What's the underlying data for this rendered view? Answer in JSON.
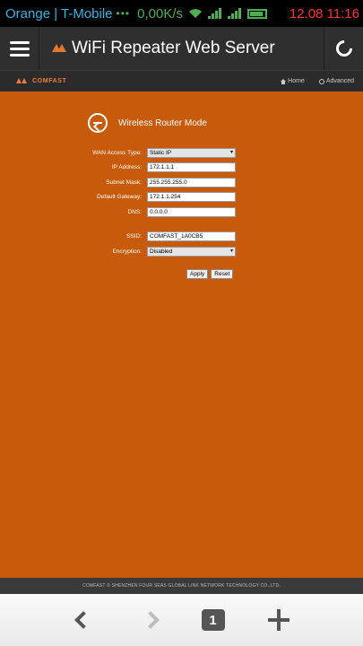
{
  "status_bar": {
    "carrier": "Orange | T-Mobile",
    "dots": "•••",
    "speed": "0,00K/s",
    "datetime": "12.08 11:16"
  },
  "app_bar": {
    "title": "WiFi Repeater Web Server"
  },
  "top_nav": {
    "brand": "COMFAST",
    "links": [
      {
        "label": "Home",
        "icon": "home-icon"
      },
      {
        "label": "Advanced",
        "icon": "gear-icon"
      }
    ]
  },
  "page": {
    "mode_title": "Wireless Router Mode",
    "fields": {
      "wan_access_type": {
        "label": "WAN Access Type:",
        "value": "Static IP"
      },
      "ip_address": {
        "label": "IP Address:",
        "value": "172.1.1.1"
      },
      "subnet_mask": {
        "label": "Subnet Mask:",
        "value": "255.255.255.0"
      },
      "default_gateway": {
        "label": "Default Gateway:",
        "value": "172.1.1.254"
      },
      "dns": {
        "label": "DNS:",
        "value": "0.0.0.0"
      },
      "ssid": {
        "label": "SSID:",
        "value": "COMFAST_1A0CB5"
      },
      "encryption": {
        "label": "Encryption:",
        "value": "Disabled"
      }
    },
    "apply_label": "Apply",
    "reset_label": "Reset"
  },
  "footer": {
    "text": "COMFAST © SHENZHEN FOUR SEAS GLOBAL LINK NETWORK TECHNOLOGY CO.,LTD."
  },
  "browser_nav": {
    "tab_count": "1"
  },
  "colors": {
    "content_bg": "#c75b0b",
    "brand_accent": "#e8803a",
    "carrier_text": "#33b5e5",
    "clock_text": "#ff3030",
    "signal_green": "#4caf50"
  }
}
